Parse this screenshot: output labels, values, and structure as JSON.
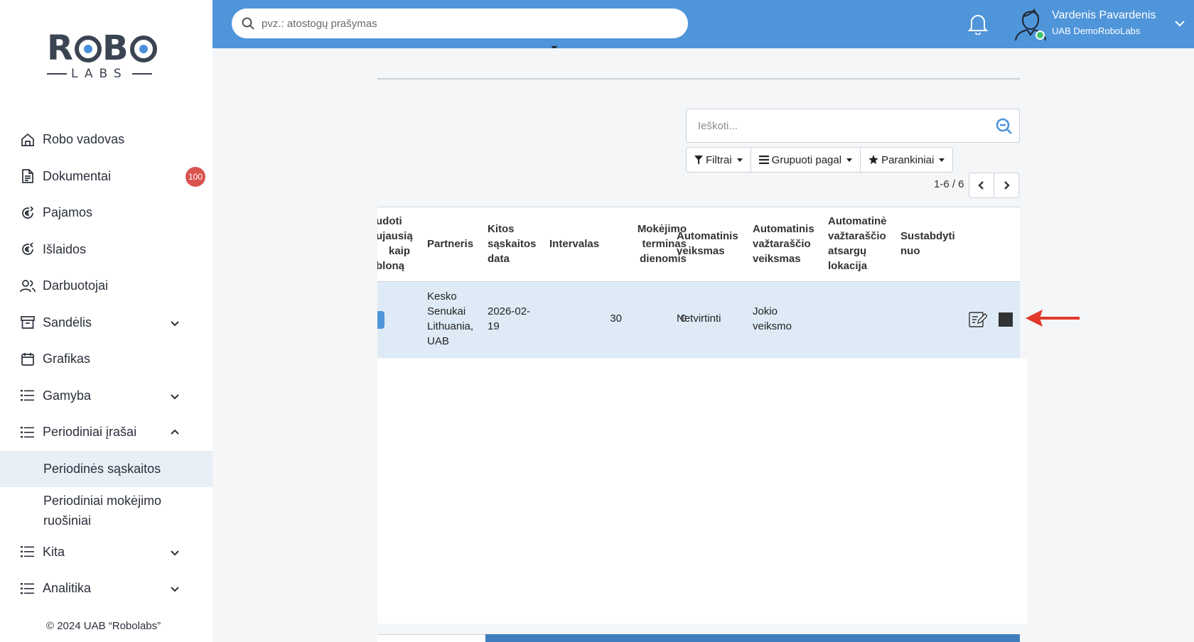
{
  "brand": {
    "logo_text": "ROBO",
    "logo_sub": "LABS"
  },
  "sidebar": {
    "items": [
      {
        "label": "Robo vadovas",
        "icon": "home-icon"
      },
      {
        "label": "Dokumentai",
        "icon": "document-icon",
        "badge": "100"
      },
      {
        "label": "Pajamos",
        "icon": "euro-income-icon"
      },
      {
        "label": "Išlaidos",
        "icon": "euro-expense-icon"
      },
      {
        "label": "Darbuotojai",
        "icon": "users-icon"
      },
      {
        "label": "Sandėlis",
        "icon": "archive-icon",
        "expandable": true
      },
      {
        "label": "Grafikas",
        "icon": "calendar-icon"
      },
      {
        "label": "Gamyba",
        "icon": "list-icon",
        "expandable": true
      },
      {
        "label": "Periodiniai įrašai",
        "icon": "list-icon",
        "expanded": true
      },
      {
        "label": "Kita",
        "icon": "list-icon",
        "expandable": true
      },
      {
        "label": "Analitika",
        "icon": "list-icon",
        "expandable": true
      }
    ],
    "subitems": [
      {
        "label": "Periodinės sąskaitos",
        "active": true
      },
      {
        "label_line1": "Periodiniai mokėjimo",
        "label_line2": "ruošiniai"
      }
    ],
    "copyright": "© 2024 UAB “Robolabs”",
    "badge_color": "#d9534f"
  },
  "topbar": {
    "search_placeholder": "pvz.: atostogų prašymas",
    "user_name": "Vardenis Pavardenis",
    "user_company": "UAB DemoRoboLabs",
    "accent": "#4f95da"
  },
  "list": {
    "search_placeholder": "Ieškoti...",
    "filters_label": "Filtrai",
    "group_label": "Grupuoti pagal",
    "favorites_label": "Parankiniai",
    "pager": "1-6 / 6"
  },
  "table": {
    "headers": {
      "use_template": [
        "udoti",
        "ujausią",
        "kaip",
        "bloną"
      ],
      "partner": [
        "Partneris"
      ],
      "next_date": [
        "Kitos",
        "sąskaitos",
        "data"
      ],
      "interval": [
        "Intervalas"
      ],
      "payment_days": [
        "Mokėjimo",
        "terminas",
        "dienomis"
      ],
      "auto_action": [
        "Automatinis",
        "veiksmas"
      ],
      "auto_waybill": [
        "Automatinis",
        "važtaraščio",
        "veiksmas"
      ],
      "auto_location": [
        "Automatinė",
        "važtaraščio",
        "atsargų",
        "lokacija"
      ],
      "paused_from": [
        "Sustabdyti",
        "nuo"
      ]
    },
    "row": {
      "partner": [
        "Kesko",
        "Senukai",
        "Lithuania,",
        "UAB"
      ],
      "next_date": [
        "2026-02-",
        "19"
      ],
      "interval": "30",
      "payment_days": "0",
      "auto_action": "Netvirtinti",
      "auto_waybill": [
        "Jokio",
        "veiksmo"
      ],
      "auto_location": "",
      "paused_from": ""
    },
    "row_color": "#deebf7",
    "arrow_color": "#e2392b"
  }
}
